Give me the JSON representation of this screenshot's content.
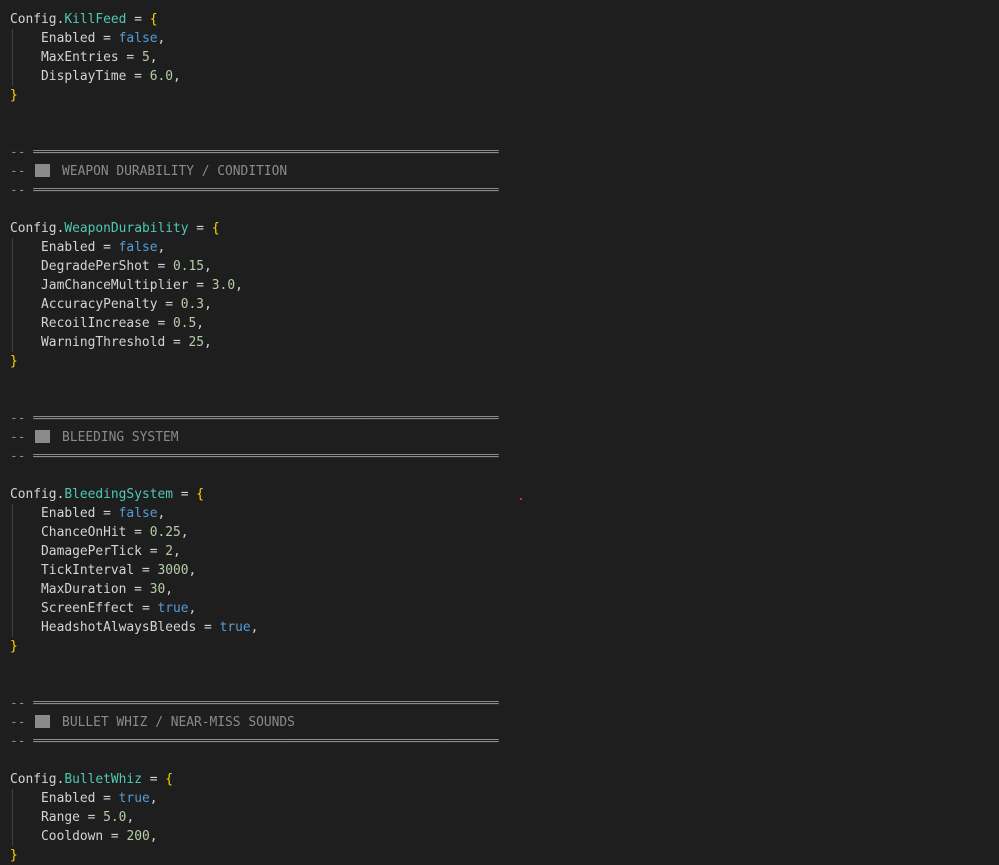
{
  "sections": [
    {
      "table": "KillFeed",
      "fields": [
        {
          "key": "Enabled",
          "value": "false",
          "type": "bool"
        },
        {
          "key": "MaxEntries",
          "value": "5",
          "type": "num"
        },
        {
          "key": "DisplayTime",
          "value": "6.0",
          "type": "num"
        }
      ]
    },
    {
      "header": "WEAPON DURABILITY / CONDITION",
      "table": "WeaponDurability",
      "fields": [
        {
          "key": "Enabled",
          "value": "false",
          "type": "bool"
        },
        {
          "key": "DegradePerShot",
          "value": "0.15",
          "type": "num"
        },
        {
          "key": "JamChanceMultiplier",
          "value": "3.0",
          "type": "num"
        },
        {
          "key": "AccuracyPenalty",
          "value": "0.3",
          "type": "num"
        },
        {
          "key": "RecoilIncrease",
          "value": "0.5",
          "type": "num"
        },
        {
          "key": "WarningThreshold",
          "value": "25",
          "type": "num"
        }
      ]
    },
    {
      "header": "BLEEDING SYSTEM",
      "table": "BleedingSystem",
      "fields": [
        {
          "key": "Enabled",
          "value": "false",
          "type": "bool"
        },
        {
          "key": "ChanceOnHit",
          "value": "0.25",
          "type": "num"
        },
        {
          "key": "DamagePerTick",
          "value": "2",
          "type": "num"
        },
        {
          "key": "TickInterval",
          "value": "3000",
          "type": "num"
        },
        {
          "key": "MaxDuration",
          "value": "30",
          "type": "num"
        },
        {
          "key": "ScreenEffect",
          "value": "true",
          "type": "bool"
        },
        {
          "key": "HeadshotAlwaysBleeds",
          "value": "true",
          "type": "bool"
        }
      ]
    },
    {
      "header": "BULLET WHIZ / NEAR-MISS SOUNDS",
      "table": "BulletWhiz",
      "fields": [
        {
          "key": "Enabled",
          "value": "true",
          "type": "bool"
        },
        {
          "key": "Range",
          "value": "5.0",
          "type": "num"
        },
        {
          "key": "Cooldown",
          "value": "200",
          "type": "num"
        }
      ]
    }
  ],
  "tokens": {
    "config": "Config",
    "comment": "--",
    "separator": "════════════════════════════════════════════════════════════════"
  },
  "colors": {
    "background": "#1e1e1e",
    "table_name": "#4ec9b0",
    "brace": "#ffd700",
    "boolean": "#569cd6",
    "number": "#b5cea8",
    "comment": "#8b8b8b"
  }
}
